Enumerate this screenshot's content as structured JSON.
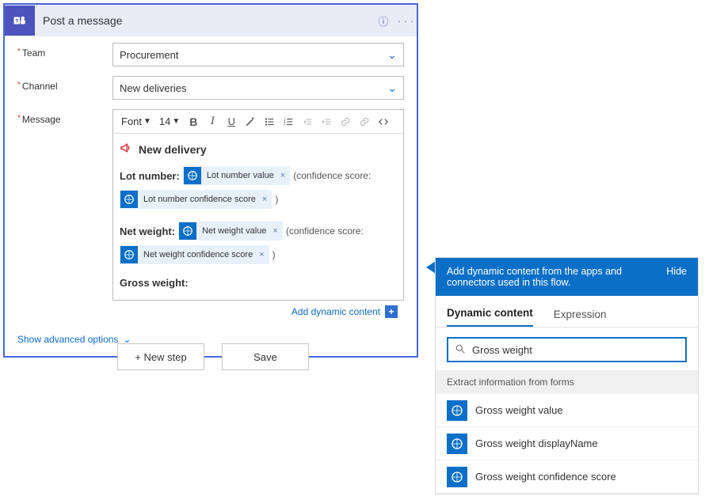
{
  "header": {
    "title": "Post a message",
    "app_icon_label": "Teams"
  },
  "fields": {
    "team": {
      "label": "Team",
      "value": "Procurement"
    },
    "channel": {
      "label": "Channel",
      "value": "New deliveries"
    },
    "message": {
      "label": "Message"
    }
  },
  "toolbar": {
    "font_label": "Font",
    "font_size": "14"
  },
  "body": {
    "heading": "New delivery",
    "lot_label": "Lot number:",
    "net_label": "Net weight:",
    "gross_label": "Gross weight:",
    "conf_open": "(confidence score:",
    "conf_close": ")",
    "tokens": {
      "lot_value": "Lot number value",
      "lot_conf": "Lot number confidence score",
      "net_value": "Net weight value",
      "net_conf": "Net weight confidence score"
    }
  },
  "links": {
    "add_dynamic": "Add dynamic content",
    "advanced": "Show advanced options"
  },
  "buttons": {
    "new_step": "+ New step",
    "save": "Save"
  },
  "panel": {
    "header_text": "Add dynamic content from the apps and connectors used in this flow.",
    "hide": "Hide",
    "tabs": {
      "dynamic": "Dynamic content",
      "expression": "Expression"
    },
    "search_value": "Gross weight",
    "group": "Extract information from forms",
    "results": [
      "Gross weight value",
      "Gross weight displayName",
      "Gross weight confidence score"
    ]
  }
}
